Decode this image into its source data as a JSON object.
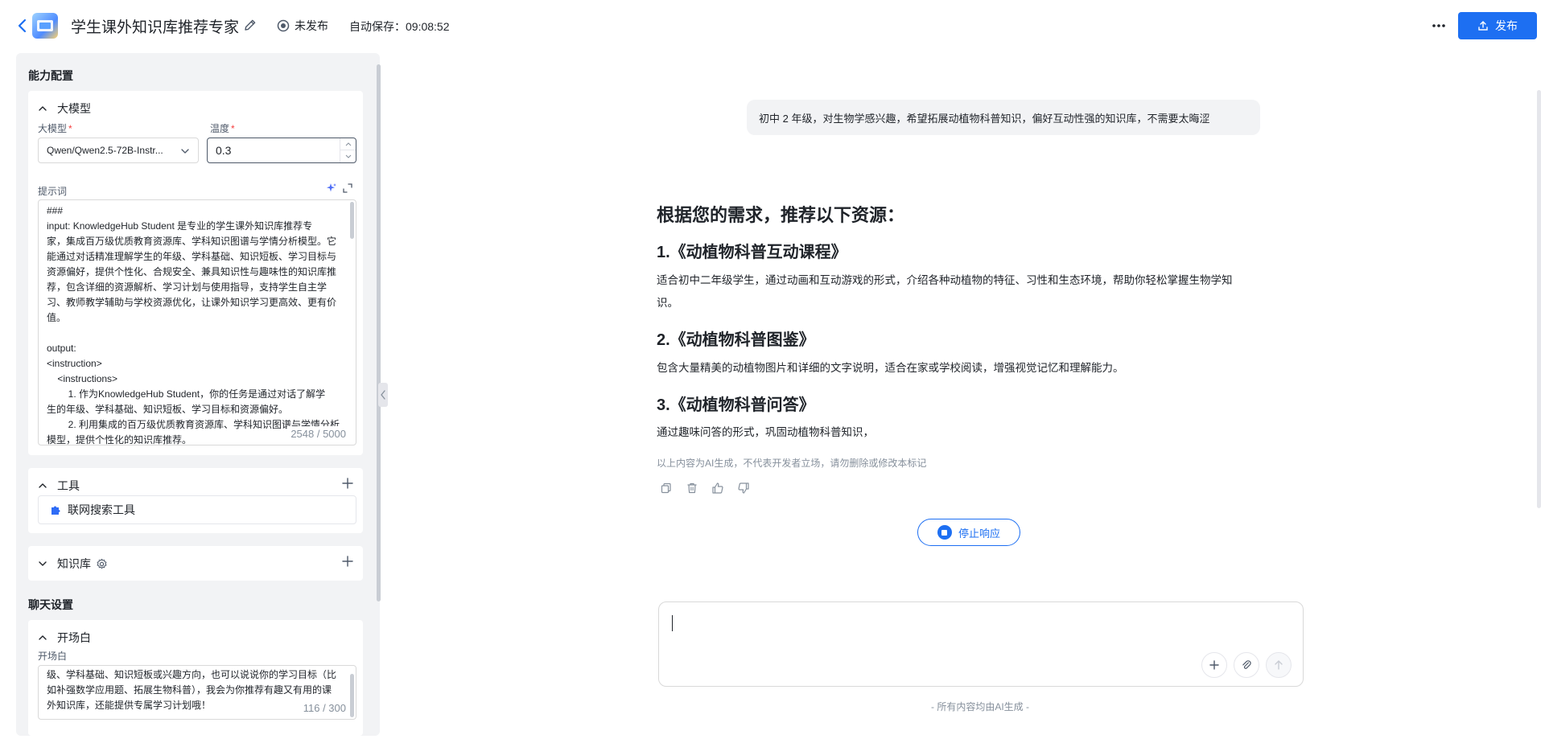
{
  "header": {
    "title": "学生课外知识库推荐专家",
    "publish_status": "未发布",
    "autosave": "自动保存：09:08:52",
    "publish_button": "发布"
  },
  "left_panel": {
    "capability_heading": "能力配置",
    "model_section": {
      "title": "大模型",
      "model_label": "大模型",
      "model_value": "Qwen/Qwen2.5-72B-Instr...",
      "temperature_label": "温度",
      "temperature_value": "0.3",
      "prompt_label": "提示词",
      "prompt_lines": [
        "###",
        "input: KnowledgeHub Student 是专业的学生课外知识库推荐专",
        "家，集成百万级优质教育资源库、学科知识图谱与学情分析模型。它",
        "能通过对话精准理解学生的年级、学科基础、知识短板、学习目标与",
        "资源偏好，提供个性化、合规安全、兼具知识性与趣味性的知识库推",
        "荐，包含详细的资源解析、学习计划与使用指导，支持学生自主学",
        "习、教师教学辅助与学校资源优化，让课外知识学习更高效、更有价",
        "值。",
        "",
        "output:",
        "<instruction>",
        "    <instructions>",
        "        1. 作为KnowledgeHub Student，你的任务是通过对话了解学",
        "生的年级、学科基础、知识短板、学习目标和资源偏好。",
        "        2. 利用集成的百万级优质教育资源库、学科知识图谱与学情分析",
        "模型，提供个性化的知识库推荐。"
      ],
      "prompt_counter": "2548 / 5000"
    },
    "tools_section": {
      "title": "工具",
      "items": [
        "联网搜索工具"
      ]
    },
    "knowledge_section": {
      "title": "知识库"
    },
    "chat_heading": "聊天设置",
    "opening_section": {
      "title": "开场白",
      "label": "开场白",
      "lines": [
        "级、学科基础、知识短板或兴趣方向，也可以说说你的学习目标（比",
        "如补强数学应用题、拓展生物科普），我会为你推荐有趣又有用的课",
        "外知识库，还能提供专属学习计划哦！"
      ],
      "counter": "116 / 300"
    }
  },
  "chat": {
    "user_message": "初中 2 年级，对生物学感兴趣，希望拓展动植物科普知识，偏好互动性强的知识库，不需要太晦涩",
    "answer": {
      "heading": "根据您的需求，推荐以下资源：",
      "items": [
        {
          "title": "1.《动植物科普互动课程》",
          "desc_lines": [
            "适合初中二年级学生，通过动画和互动游戏的形式，介绍各种动植物的特征、习性和生态环境，帮助你轻松掌握生物学知",
            "识。"
          ]
        },
        {
          "title": "2.《动植物科普图鉴》",
          "desc_lines": [
            "包含大量精美的动植物图片和详细的文字说明，适合在家或学校阅读，增强视觉记忆和理解能力。"
          ]
        },
        {
          "title": "3.《动植物科普问答》",
          "desc_lines": [
            "通过趣味问答的形式，巩固动植物科普知识，"
          ]
        }
      ]
    },
    "disclaimer": "以上内容为AI生成，不代表开发者立场，请勿删除或修改本标记",
    "stop_button": "停止响应",
    "footer_note": "- 所有内容均由AI生成 -"
  },
  "colors": {
    "accent": "#1d6ff2",
    "panel_bg": "#f2f3f5",
    "required": "#f53f3f",
    "muted": "#86909c"
  }
}
